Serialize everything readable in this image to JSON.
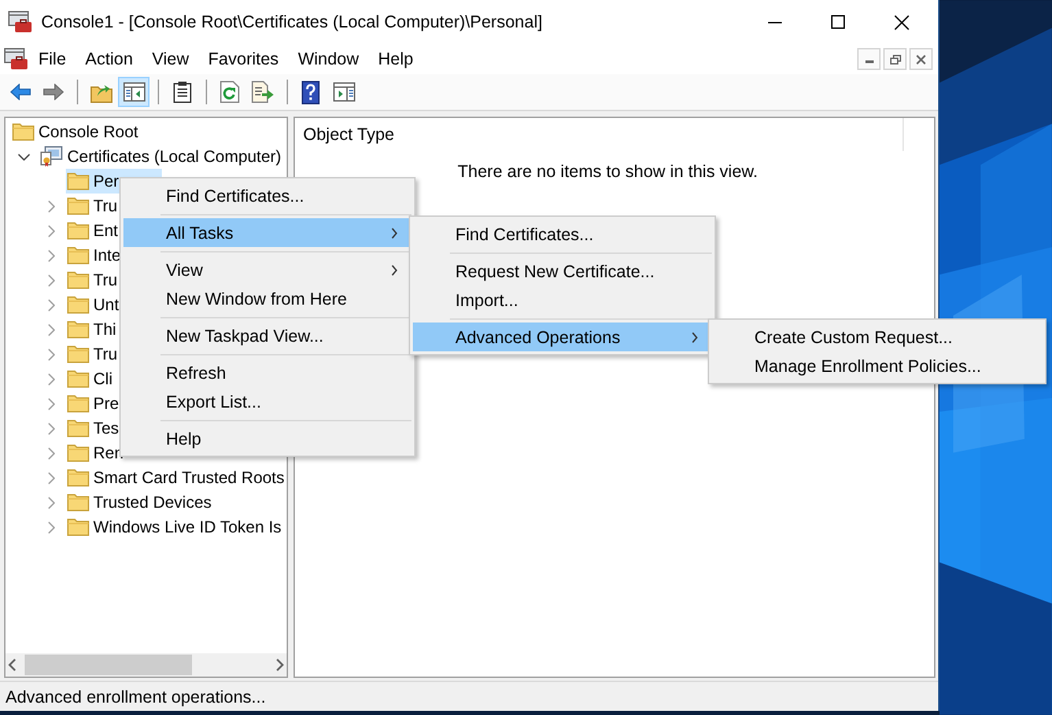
{
  "window": {
    "title": "Console1 - [Console Root\\Certificates (Local Computer)\\Personal]"
  },
  "menu_bar": [
    "File",
    "Action",
    "View",
    "Favorites",
    "Window",
    "Help"
  ],
  "toolbar": [
    {
      "kind": "back",
      "pressed": false
    },
    {
      "kind": "forward",
      "pressed": false
    },
    {
      "kind": "separator"
    },
    {
      "kind": "up",
      "pressed": false
    },
    {
      "kind": "console-tree",
      "pressed": true
    },
    {
      "kind": "separator"
    },
    {
      "kind": "properties",
      "pressed": false
    },
    {
      "kind": "separator"
    },
    {
      "kind": "refresh",
      "pressed": false
    },
    {
      "kind": "export",
      "pressed": false
    },
    {
      "kind": "separator"
    },
    {
      "kind": "help",
      "pressed": false
    },
    {
      "kind": "action-pane",
      "pressed": false
    }
  ],
  "tree": [
    {
      "label": "Console Root",
      "kind": "folder",
      "selected": false,
      "children": [
        {
          "label": "Certificates (Local Computer)",
          "kind": "certificates",
          "expanded": true,
          "selected": false,
          "children": [
            {
              "label": "Per",
              "kind": "folder",
              "selected": true
            },
            {
              "label": "Tru",
              "kind": "folder",
              "expanded": false,
              "selected": false
            },
            {
              "label": "Ent",
              "kind": "folder",
              "expanded": false,
              "selected": false
            },
            {
              "label": "Inte",
              "kind": "folder",
              "expanded": false,
              "selected": false
            },
            {
              "label": "Tru",
              "kind": "folder",
              "expanded": false,
              "selected": false
            },
            {
              "label": "Unt",
              "kind": "folder",
              "expanded": false,
              "selected": false
            },
            {
              "label": "Thi",
              "kind": "folder",
              "expanded": false,
              "selected": false
            },
            {
              "label": "Tru",
              "kind": "folder",
              "expanded": false,
              "selected": false
            },
            {
              "label": "Cli",
              "kind": "folder",
              "expanded": false,
              "selected": false
            },
            {
              "label": "Pre",
              "kind": "folder",
              "expanded": false,
              "selected": false
            },
            {
              "label": "Tes",
              "kind": "folder",
              "expanded": false,
              "selected": false
            },
            {
              "label": "Ren",
              "kind": "folder",
              "expanded": false,
              "selected": false
            },
            {
              "label": "Smart Card Trusted Roots",
              "kind": "folder",
              "expanded": false,
              "selected": false
            },
            {
              "label": "Trusted Devices",
              "kind": "folder",
              "expanded": false,
              "selected": false
            },
            {
              "label": "Windows Live ID Token Is",
              "kind": "folder",
              "expanded": false,
              "selected": false
            }
          ]
        }
      ]
    }
  ],
  "list_view": {
    "columns": [
      "Object Type"
    ],
    "empty_message": "There are no items to show in this view."
  },
  "context_menus": [
    {
      "items": [
        {
          "kind": "item",
          "label": "Find Certificates...",
          "selected": false,
          "submenu": false
        },
        {
          "kind": "separator"
        },
        {
          "kind": "item",
          "label": "All Tasks",
          "selected": true,
          "submenu": true
        },
        {
          "kind": "separator"
        },
        {
          "kind": "item",
          "label": "View",
          "selected": false,
          "submenu": true
        },
        {
          "kind": "item",
          "label": "New Window from Here",
          "selected": false,
          "submenu": false
        },
        {
          "kind": "separator"
        },
        {
          "kind": "item",
          "label": "New Taskpad View...",
          "selected": false,
          "submenu": false
        },
        {
          "kind": "separator"
        },
        {
          "kind": "item",
          "label": "Refresh",
          "selected": false,
          "submenu": false
        },
        {
          "kind": "item",
          "label": "Export List...",
          "selected": false,
          "submenu": false
        },
        {
          "kind": "separator"
        },
        {
          "kind": "item",
          "label": "Help",
          "selected": false,
          "submenu": false
        }
      ]
    },
    {
      "items": [
        {
          "kind": "item",
          "label": "Find Certificates...",
          "selected": false,
          "submenu": false
        },
        {
          "kind": "separator"
        },
        {
          "kind": "item",
          "label": "Request New Certificate...",
          "selected": false,
          "submenu": false
        },
        {
          "kind": "item",
          "label": "Import...",
          "selected": false,
          "submenu": false
        },
        {
          "kind": "separator"
        },
        {
          "kind": "item",
          "label": "Advanced Operations",
          "selected": true,
          "submenu": true
        }
      ]
    },
    {
      "items": [
        {
          "kind": "item",
          "label": "Create Custom Request...",
          "selected": false,
          "submenu": false
        },
        {
          "kind": "item",
          "label": "Manage Enrollment Policies...",
          "selected": false,
          "submenu": false
        }
      ]
    }
  ],
  "status_bar": "Advanced enrollment operations..."
}
